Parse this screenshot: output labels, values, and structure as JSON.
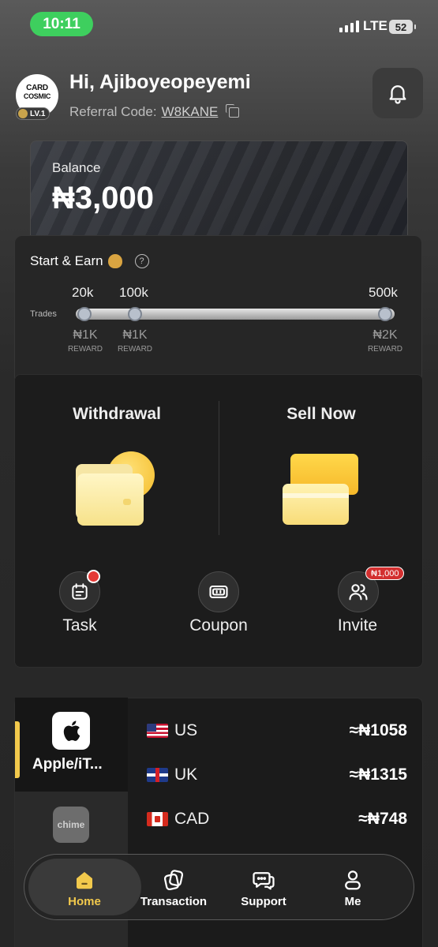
{
  "status_bar": {
    "time": "10:11",
    "network": "LTE",
    "battery": "52"
  },
  "header": {
    "logo_line1": "CARD",
    "logo_line2": "COSMIC",
    "level": "LV.1",
    "greeting": "Hi, Ajiboyeopeyemi",
    "referral_label": "Referral Code:",
    "referral_code": "W8KANE"
  },
  "balance": {
    "label": "Balance",
    "amount": "₦3,000"
  },
  "start_earn": {
    "title": "Start & Earn",
    "trades_label": "Trades",
    "progress_fraction": 0,
    "milestones": [
      {
        "target": "20k",
        "reward": "₦1K",
        "reward_label": "REWARD"
      },
      {
        "target": "100k",
        "reward": "₦1K",
        "reward_label": "REWARD"
      },
      {
        "target": "500k",
        "reward": "₦2K",
        "reward_label": "REWARD"
      }
    ]
  },
  "actions": {
    "withdrawal": "Withdrawal",
    "sell_now": "Sell Now"
  },
  "quick": {
    "task": "Task",
    "coupon": "Coupon",
    "invite": "Invite",
    "invite_badge": "₦1,000"
  },
  "rates": {
    "selected_card": "Apple/iT...",
    "other_card": "chime",
    "rows": [
      {
        "country": "US",
        "rate": "≈₦1058",
        "flag": "flag-us"
      },
      {
        "country": "UK",
        "rate": "≈₦1315",
        "flag": "flag-uk"
      },
      {
        "country": "CAD",
        "rate": "≈₦748",
        "flag": "flag-ca"
      }
    ]
  },
  "nav": {
    "home": "Home",
    "transaction": "Transaction",
    "support": "Support",
    "me": "Me",
    "active": "home"
  },
  "colors": {
    "accent": "#f2c94c",
    "status_green": "#3ecf5e",
    "badge_red": "#d32f2f"
  }
}
